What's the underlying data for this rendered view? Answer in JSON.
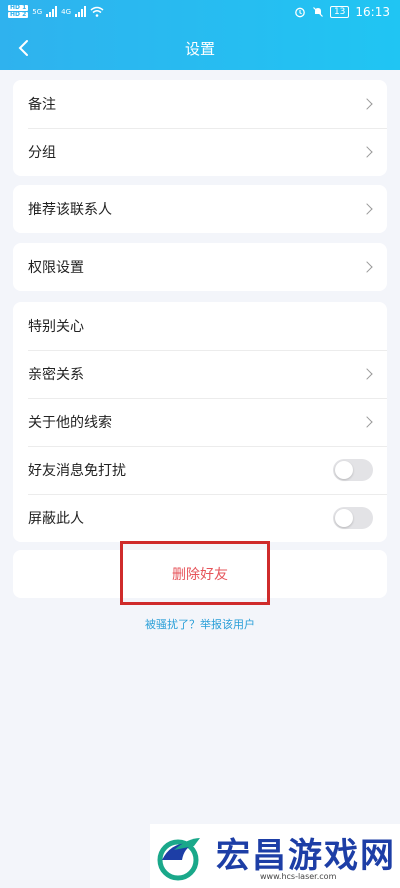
{
  "status_bar": {
    "hd1": "HD 1",
    "hd2": "HD 2",
    "net1": "5G",
    "net2": "4G",
    "battery": "13",
    "time": "16:13"
  },
  "header": {
    "title": "设置"
  },
  "sections": {
    "group1": [
      {
        "label": "备注"
      },
      {
        "label": "分组"
      }
    ],
    "recommend": {
      "label": "推荐该联系人"
    },
    "permission": {
      "label": "权限设置"
    },
    "group4": [
      {
        "label": "特别关心"
      },
      {
        "label": "亲密关系"
      },
      {
        "label": "关于他的线索"
      },
      {
        "label": "好友消息免打扰",
        "toggle": false
      },
      {
        "label": "屏蔽此人",
        "toggle": false
      }
    ]
  },
  "delete_button": {
    "label": "删除好友"
  },
  "report_link": {
    "label": "被骚扰了？举报该用户"
  },
  "watermark": {
    "name": "宏昌游戏网",
    "url": "www.hcs-laser.com"
  },
  "colors": {
    "header": "#2fb2ee",
    "delete": "#e6545a",
    "link": "#2a9fd8",
    "highlight": "#cf2b2b"
  }
}
